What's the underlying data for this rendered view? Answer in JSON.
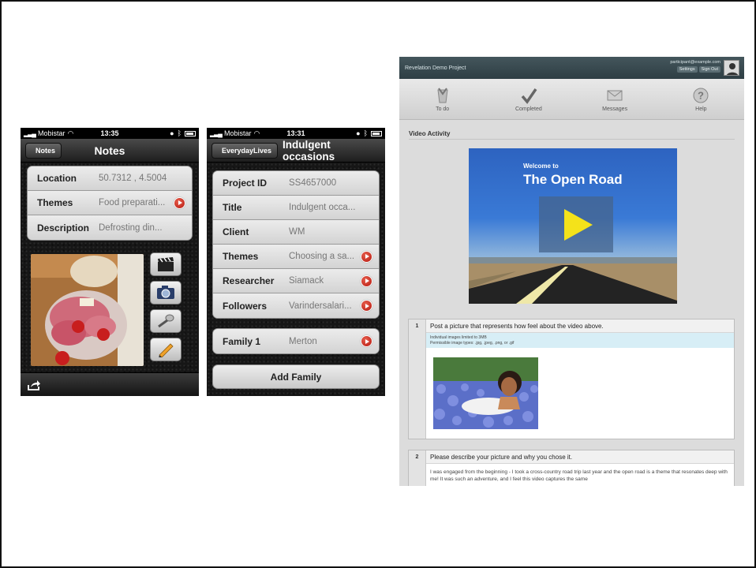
{
  "notes_screen": {
    "status": {
      "carrier": "Mobistar",
      "time": "13:35"
    },
    "nav": {
      "back_label": "Notes",
      "title": "Notes"
    },
    "rows": [
      {
        "label": "Location",
        "value": "50.7312 , 4.5004",
        "has_arrow": false
      },
      {
        "label": "Themes",
        "value": "Food preparati...",
        "has_arrow": true
      },
      {
        "label": "Description",
        "value": "Defrosting din...",
        "has_arrow": false
      }
    ],
    "media_buttons": [
      "clapperboard-icon",
      "camera-icon",
      "microphone-icon",
      "pencil-icon"
    ],
    "toolbar": {
      "share_icon": "share-icon"
    }
  },
  "project_screen": {
    "status": {
      "carrier": "Mobistar",
      "time": "13:31"
    },
    "nav": {
      "back_label": "EverydayLives",
      "title": "Indulgent occasions"
    },
    "rows": [
      {
        "label": "Project ID",
        "value": "SS4657000",
        "has_arrow": false
      },
      {
        "label": "Title",
        "value": "Indulgent occa...",
        "has_arrow": false
      },
      {
        "label": "Client",
        "value": "WM",
        "has_arrow": false
      },
      {
        "label": "Themes",
        "value": "Choosing a sa...",
        "has_arrow": true
      },
      {
        "label": "Researcher",
        "value": "Siamack",
        "has_arrow": true
      },
      {
        "label": "Followers",
        "value": "Varindersalari...",
        "has_arrow": true
      }
    ],
    "family_row": {
      "label": "Family 1",
      "value": "Merton",
      "has_arrow": true
    },
    "add_family_label": "Add Family"
  },
  "web_app": {
    "header": {
      "project_name": "Revelation Demo Project",
      "user_email": "participant@example.com",
      "settings_label": "Settings",
      "signout_label": "Sign Out"
    },
    "nav": [
      {
        "label": "To do",
        "icon": "todo-icon"
      },
      {
        "label": "Completed",
        "icon": "checkmark-icon"
      },
      {
        "label": "Messages",
        "icon": "envelope-icon"
      },
      {
        "label": "Help",
        "icon": "help-icon"
      }
    ],
    "section_title": "Video Activity",
    "video": {
      "subtitle": "Welcome to",
      "title": "The Open Road"
    },
    "questions": [
      {
        "number": "1",
        "text": "Post a picture that represents how feel about the video above.",
        "info_line1": "Individual images limited to 3MB",
        "info_line2": "Permissible image types: .jpg, .jpeg, .png, or .gif"
      },
      {
        "number": "2",
        "text": "Please describe your picture and why you chose it.",
        "answer": "I was engaged from the beginning - I took a cross-country road trip last year and the open road is a theme that resonates deep with me! It was such an adventure, and I feel this video captures the same"
      }
    ]
  }
}
